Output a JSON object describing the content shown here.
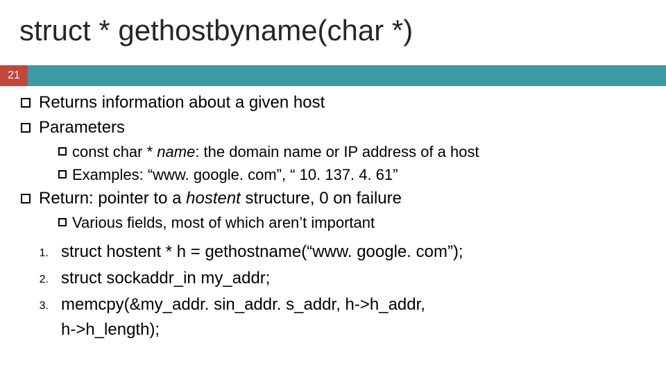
{
  "slide_number": "21",
  "title": "struct * gethostbyname(char *)",
  "bullets": {
    "l1a": "Returns information about a given host",
    "l1b": "Parameters",
    "l2a_pre": "const char * ",
    "l2a_ital": "name",
    "l2a_post": ": the domain name or IP address of a host",
    "l2b": "Examples: “www. google. com”, “ 10. 137. 4. 61”",
    "l1c_pre": "Return: pointer to a ",
    "l1c_ital": "hostent",
    "l1c_post": " structure, 0 on failure",
    "l2c": "Various fields, most of which aren’t important"
  },
  "numbered": {
    "n1": "1.",
    "n2": "2.",
    "n3": "3.",
    "t1": "struct hostent * h = gethostname(“www. google. com”);",
    "t2": "struct sockaddr_in my_addr;",
    "t3a": "memcpy(&my_addr. sin_addr. s_addr, h->h_addr,",
    "t3b": "h->h_length);"
  }
}
